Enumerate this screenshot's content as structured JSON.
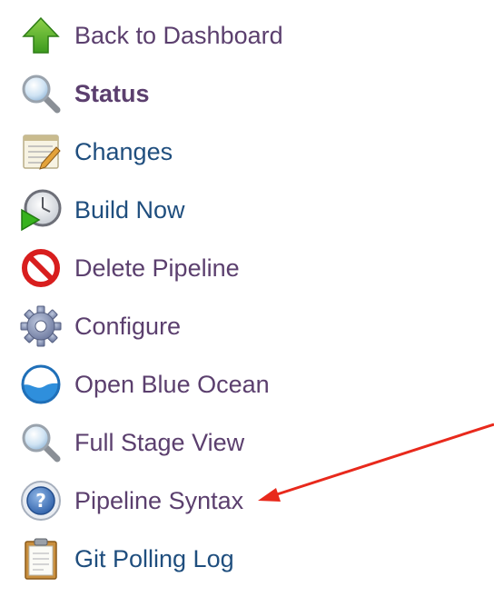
{
  "tasks": [
    {
      "label": "Back to Dashboard",
      "icon": "up-arrow-icon",
      "bold": false,
      "color": "#5b3f6e"
    },
    {
      "label": "Status",
      "icon": "magnifier-icon",
      "bold": true,
      "color": "#5b3f6e"
    },
    {
      "label": "Changes",
      "icon": "notepad-icon",
      "bold": false,
      "color": "#1f4e7e"
    },
    {
      "label": "Build Now",
      "icon": "clock-play-icon",
      "bold": false,
      "color": "#1f4e7e"
    },
    {
      "label": "Delete Pipeline",
      "icon": "no-entry-icon",
      "bold": false,
      "color": "#5b3f6e"
    },
    {
      "label": "Configure",
      "icon": "gear-icon",
      "bold": false,
      "color": "#5b3f6e"
    },
    {
      "label": "Open Blue Ocean",
      "icon": "blue-ocean-icon",
      "bold": false,
      "color": "#5b3f6e"
    },
    {
      "label": "Full Stage View",
      "icon": "magnifier-icon",
      "bold": false,
      "color": "#5b3f6e"
    },
    {
      "label": "Pipeline Syntax",
      "icon": "help-icon",
      "bold": false,
      "color": "#5b3f6e"
    },
    {
      "label": "Git Polling Log",
      "icon": "clipboard-icon",
      "bold": false,
      "color": "#1f4e7e"
    }
  ],
  "annotation": {
    "icon": "red-arrow-icon",
    "color": "#e8291c",
    "points_to": "Pipeline Syntax"
  }
}
